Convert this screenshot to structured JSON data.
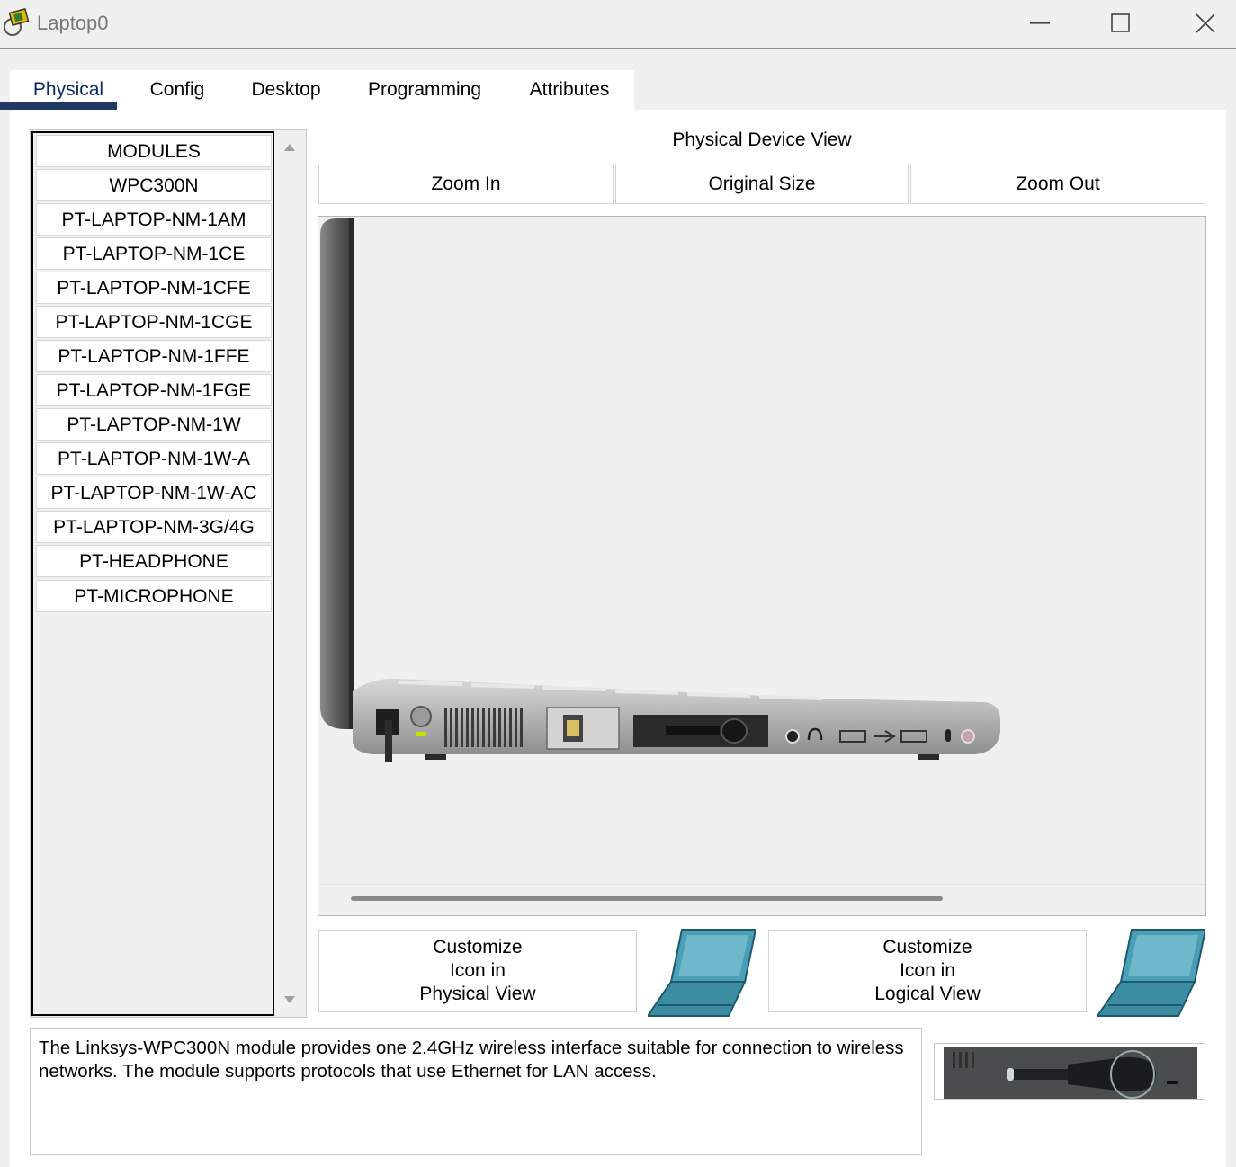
{
  "window": {
    "title": "Laptop0"
  },
  "tabs": [
    {
      "label": "Physical",
      "active": true
    },
    {
      "label": "Config",
      "active": false
    },
    {
      "label": "Desktop",
      "active": false
    },
    {
      "label": "Programming",
      "active": false
    },
    {
      "label": "Attributes",
      "active": false
    }
  ],
  "modules": {
    "items": [
      "MODULES",
      "WPC300N",
      "PT-LAPTOP-NM-1AM",
      "PT-LAPTOP-NM-1CE",
      "PT-LAPTOP-NM-1CFE",
      "PT-LAPTOP-NM-1CGE",
      "PT-LAPTOP-NM-1FFE",
      "PT-LAPTOP-NM-1FGE",
      "PT-LAPTOP-NM-1W",
      "PT-LAPTOP-NM-1W-A",
      "PT-LAPTOP-NM-1W-AC",
      "PT-LAPTOP-NM-3G/4G",
      "PT-HEADPHONE",
      "PT-MICROPHONE"
    ]
  },
  "device_view": {
    "title": "Physical Device View",
    "zoom_in": "Zoom In",
    "original_size": "Original Size",
    "zoom_out": "Zoom Out"
  },
  "customize": {
    "physical": [
      "Customize",
      "Icon in",
      "Physical View"
    ],
    "logical": [
      "Customize",
      "Icon in",
      "Logical View"
    ]
  },
  "description": {
    "text": "The Linksys-WPC300N module provides one 2.4GHz wireless interface suitable for connection to wireless networks. The module supports protocols that use Ethernet for LAN access."
  },
  "colors": {
    "accent": "#1f3864",
    "laptop_icon": "#4a9fb5"
  }
}
